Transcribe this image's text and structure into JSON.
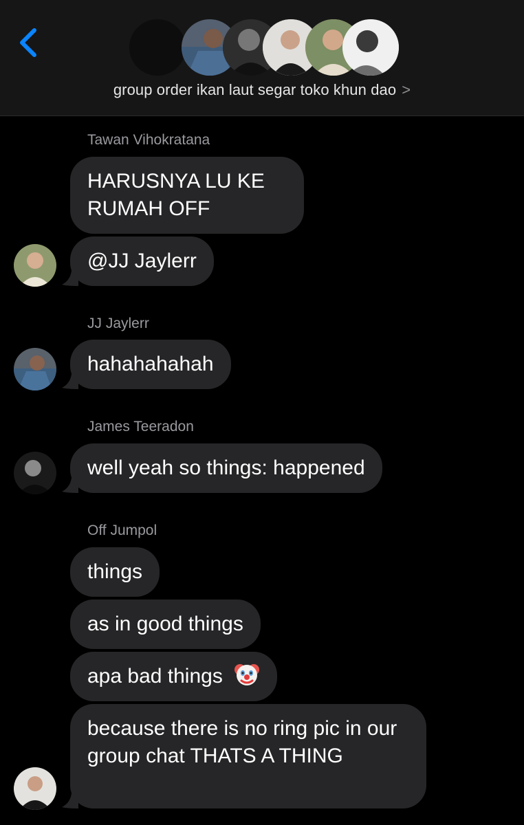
{
  "header": {
    "group_name": "group order ikan laut segar toko khun dao",
    "chevron": ">"
  },
  "messages": [
    {
      "sender": "Tawan Vihokratana",
      "bubbles": [
        "HARUSNYA LU KE RUMAH OFF",
        "@JJ Jaylerr"
      ]
    },
    {
      "sender": "JJ Jaylerr",
      "bubbles": [
        "hahahahahah"
      ]
    },
    {
      "sender": "James Teeradon",
      "bubbles": [
        "well yeah so things: happened"
      ]
    },
    {
      "sender": "Off Jumpol",
      "bubbles": [
        "things",
        "as in good things",
        "apa bad things",
        "because there is no ring pic in our group chat THATS A THING"
      ]
    }
  ],
  "icons": {
    "back": "chevron-left-icon",
    "clown_emoji": "clown-face-emoji"
  },
  "colors": {
    "accent": "#0a84ff",
    "bubble": "#262628",
    "header_bg": "#161616",
    "sender_text": "#9a9a9f"
  }
}
